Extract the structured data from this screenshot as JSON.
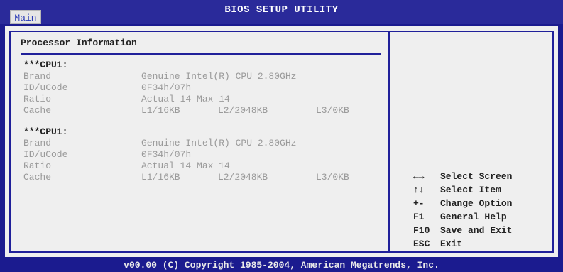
{
  "header": {
    "title": "BIOS SETUP UTILITY",
    "tab_main": "Main"
  },
  "section": {
    "title": "Processor Information"
  },
  "cpus": [
    {
      "heading": "***CPU1:",
      "brand_label": "Brand",
      "brand_value": "Genuine Intel(R) CPU 2.80GHz",
      "ucode_label": "ID/uCode",
      "ucode_value": "0F34h/07h",
      "ratio_label": "Ratio",
      "ratio_value": "Actual 14 Max 14",
      "cache_label": "Cache",
      "cache_l1": "L1/16KB",
      "cache_l2": "L2/2048KB",
      "cache_l3": "L3/0KB"
    },
    {
      "heading": "***CPU1:",
      "brand_label": "Brand",
      "brand_value": "Genuine Intel(R) CPU 2.80GHz",
      "ucode_label": "ID/uCode",
      "ucode_value": "0F34h/07h",
      "ratio_label": "Ratio",
      "ratio_value": "Actual 14 Max 14",
      "cache_label": "Cache",
      "cache_l1": "L1/16KB",
      "cache_l2": "L2/2048KB",
      "cache_l3": "L3/0KB"
    }
  ],
  "help": [
    {
      "key": "←→",
      "desc": "Select Screen"
    },
    {
      "key": "↑↓",
      "desc": "Select Item"
    },
    {
      "key": "+-",
      "desc": "Change Option"
    },
    {
      "key": "F1",
      "desc": "General Help"
    },
    {
      "key": "F10",
      "desc": "Save and Exit"
    },
    {
      "key": "ESC",
      "desc": "Exit"
    }
  ],
  "footer": {
    "text": "v00.00 (C) Copyright 1985-2004, American Megatrends, Inc."
  },
  "colors": {
    "background": "#efefef",
    "frame_blue": "#1b1b8f",
    "dim_text": "#9a9a9a",
    "tab_text": "#2b3bb6"
  }
}
